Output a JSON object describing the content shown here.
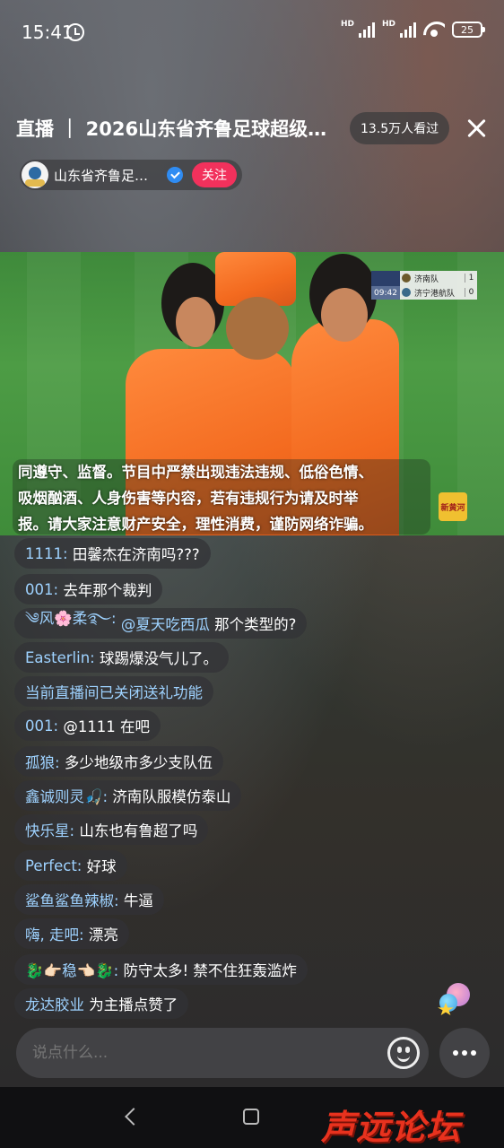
{
  "status_bar": {
    "time": "15:41",
    "signal_label_1": "HD",
    "signal_label_2": "HD",
    "battery": "25"
  },
  "header": {
    "title": "直播 ｜ 2026山东省齐鲁足球超级…",
    "viewers": "13.5万人看过",
    "anchor_name": "山东省齐鲁足…",
    "follow_label": "关注"
  },
  "video": {
    "scoreboard": {
      "clock": "09:42",
      "team1": "济南队",
      "score1": "1",
      "team2": "济宁港航队",
      "score2": "0"
    },
    "notice_lines": [
      "同遵守、监督。节目中严禁出现违法违规、低俗色情、",
      "吸烟酗酒、人身伤害等内容，若有违规行为请及时举",
      "报。请大家注意财产安全，理性消费，谨防网络诈骗。"
    ],
    "channel_logo": "新黄河"
  },
  "comments": [
    {
      "user": "1111:",
      "msg": "田馨杰在济南吗???"
    },
    {
      "user": "001:",
      "msg": "去年那个裁判"
    },
    {
      "user": "༄风🌸柔࿐:",
      "msg": "@夏天吃西瓜 那个类型的?",
      "msg_highlight": "@夏天吃西瓜"
    },
    {
      "user": "Easterlin:",
      "msg": "球踢爆没气儿了。"
    },
    {
      "system": "当前直播间已关闭送礼功能"
    },
    {
      "user": "001:",
      "msg": "@1111 在吧"
    },
    {
      "user": "孤狼:",
      "msg": "多少地级市多少支队伍"
    },
    {
      "user": "鑫诚则灵🎣:",
      "msg": "济南队服模仿泰山"
    },
    {
      "user": "快乐星:",
      "msg": "山东也有鲁超了吗"
    },
    {
      "user": "Perfect:",
      "msg": "好球"
    },
    {
      "user": "鲨鱼鲨鱼辣椒:",
      "msg": "牛逼"
    },
    {
      "user": "嗨, 走吧:",
      "msg": "漂亮"
    },
    {
      "user": "🐉👉🏻稳👈🏻🐉:",
      "msg": "防守太多! 禁不住狂轰滥炸"
    },
    {
      "user": "龙达胶业",
      "msg": "为主播点赞了"
    }
  ],
  "input": {
    "placeholder": "说点什么..."
  },
  "watermark": "声远论坛",
  "colors": {
    "accent_pink": "#f2315c",
    "username_blue": "#9ed2ff",
    "verified_blue": "#2f8cf3"
  },
  "icons": [
    "alarm-icon",
    "signal-icon",
    "wifi-icon",
    "battery-icon",
    "close-icon",
    "verified-icon",
    "gift-icon",
    "emoji-icon",
    "more-icon",
    "back-icon",
    "home-icon"
  ]
}
